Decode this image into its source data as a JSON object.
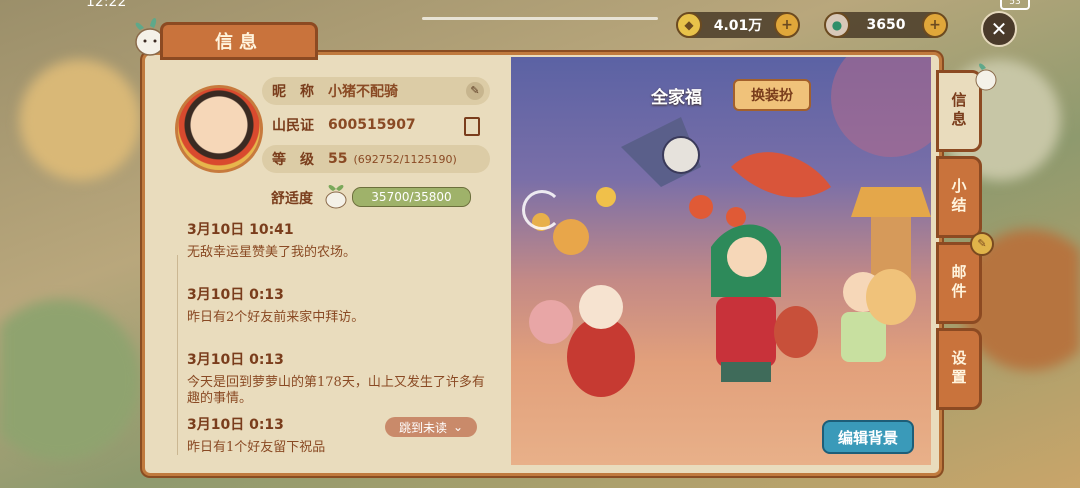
{
  "status": {
    "time": "12:22",
    "battery": "53"
  },
  "resources": [
    {
      "icon": "coin-icon",
      "value": "4.01万"
    },
    {
      "icon": "gem-icon",
      "value": "3650"
    }
  ],
  "panel": {
    "title": "信息"
  },
  "profile": {
    "nickname_label": "昵　称",
    "nickname": "小猪不配骑",
    "id_label": "山民证",
    "id": "600515907",
    "level_label": "等　级",
    "level": "55",
    "level_exp": "(692752/1125190)",
    "comfort_label": "舒适度",
    "comfort_text": "35700/35800",
    "comfort_fraction": 0.997
  },
  "logs": [
    {
      "date": "3月10日  10:41",
      "text": "无敌幸运星赞美了我的农场。"
    },
    {
      "date": "3月10日  0:13",
      "text": "昨日有2个好友前来家中拜访。"
    },
    {
      "date": "3月10日  0:13",
      "text": "今天是回到萝萝山的第178天，山上又发生了许多有趣的事情。"
    },
    {
      "date": "3月10日  0:13",
      "text": "昨日有1个好友留下祝品"
    }
  ],
  "jump_label": "跳到未读",
  "scene": {
    "title": "全家福",
    "outfit_button": "换装扮",
    "edit_bg_button": "编辑背景"
  },
  "tabs": [
    "信息",
    "小结",
    "邮件",
    "设置"
  ]
}
